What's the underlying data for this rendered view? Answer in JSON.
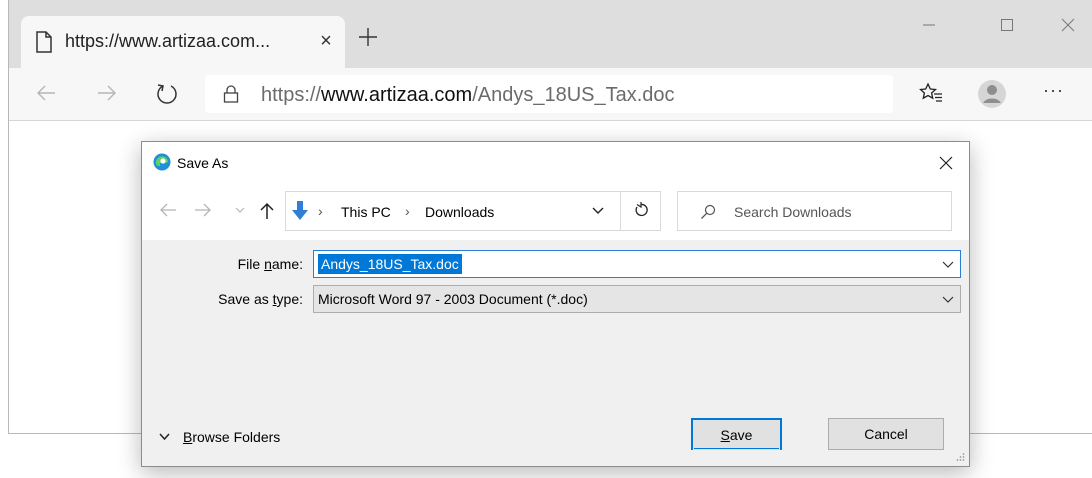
{
  "browser": {
    "tab": {
      "title": "https://www.artizaa.com...",
      "close_glyph": "×",
      "icon": "page-icon"
    },
    "new_tab_icon": "plus-icon",
    "window_controls": [
      "minimize-icon",
      "maximize-icon",
      "close-icon"
    ],
    "toolbar": {
      "back_icon": "back-arrow-icon",
      "forward_icon": "forward-arrow-icon",
      "refresh_icon": "refresh-icon",
      "address": {
        "prefix": "https://",
        "domain": "www.artizaa.com",
        "path": "/Andys_18US_Tax.doc"
      },
      "favorites_icon": "favorites-icon",
      "profile_icon": "profile-icon",
      "more_glyph": "···"
    }
  },
  "dialog": {
    "title": "Save As",
    "nav": {
      "breadcrumb": [
        "This PC",
        "Downloads"
      ],
      "breadcrumb_sep": "›",
      "search_placeholder": "Search Downloads"
    },
    "fields": {
      "file_name_label_pre": "File ",
      "file_name_label_ul": "n",
      "file_name_label_post": "ame:",
      "file_name_value": "Andys_18US_Tax.doc",
      "save_type_label_pre": "Save as ",
      "save_type_label_ul": "t",
      "save_type_label_post": "ype:",
      "save_type_value": "Microsoft Word 97 - 2003 Document (*.doc)"
    },
    "browse_folders_ul": "B",
    "browse_folders_rest": "rowse Folders",
    "save_button_ul": "S",
    "save_button_rest": "ave",
    "cancel_button": "Cancel"
  },
  "colors": {
    "accent": "#0078d7",
    "titlebar": "#dedede",
    "dialog_body": "#f0f0f0"
  }
}
